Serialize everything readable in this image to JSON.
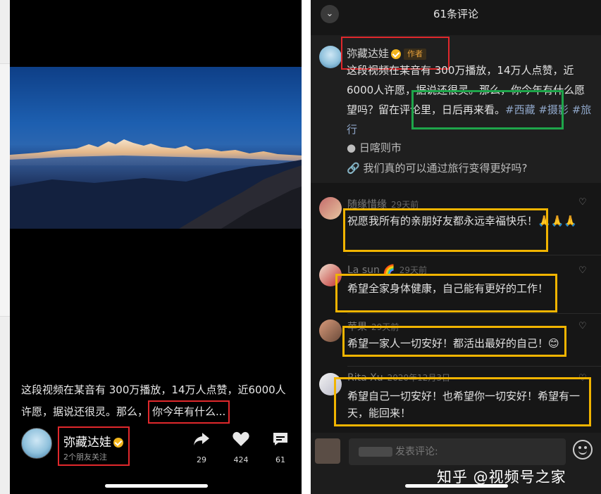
{
  "left": {
    "caption_lead": "这段视频在某音有 300万播放，14万人点赞，近6000人许愿，据说还很灵。那么，",
    "caption_highlight": "你今年有什么...",
    "author_name": "弥藏达娃",
    "followers": "2个朋友关注",
    "actions": {
      "share_count": "29",
      "like_count": "424",
      "comment_count": "61"
    }
  },
  "right": {
    "title": "61条评论",
    "post": {
      "author_name": "弥藏达娃",
      "author_tag": "作者",
      "text": "这段视频在某音有 300万播放，14万人点赞，近6000人许愿，据说还很灵。那么，你今年有什么愿望吗？留在评论里，日后再来看。",
      "tags": "#西藏 #摄影 #旅行",
      "location": "日喀则市",
      "link": "我们真的可以通过旅行变得更好吗?"
    },
    "comments": [
      {
        "name": "随缘惜缘",
        "time": "29天前",
        "text": "祝愿我所有的亲朋好友都永远幸福快乐！🙏🙏🙏"
      },
      {
        "name": "La sun 🌈",
        "time": "29天前",
        "text": "希望全家身体健康，自己能有更好的工作！"
      },
      {
        "name": "苹果",
        "time": "29天前",
        "text": "希望一家人一切安好！都活出最好的自己！😊"
      },
      {
        "name": "Rita Xu",
        "time": "2020年12月3日",
        "text": "希望自己一切安好！也希望你一切安好！希望有一天，能回来！"
      }
    ],
    "input_placeholder": "发表评论:",
    "watermark": "知乎 @视频号之家"
  },
  "colors": {
    "red_box": "#e0282c",
    "green_box": "#1ea54a",
    "yellow_box": "#f1b400",
    "bg_dark": "#161616",
    "verified_badge": "#f2b51d"
  },
  "icons": [
    "share-icon",
    "heart-icon",
    "comment-icon",
    "chevron-down-icon",
    "location-icon",
    "link-icon",
    "emoji-icon",
    "verified-badge-icon"
  ]
}
